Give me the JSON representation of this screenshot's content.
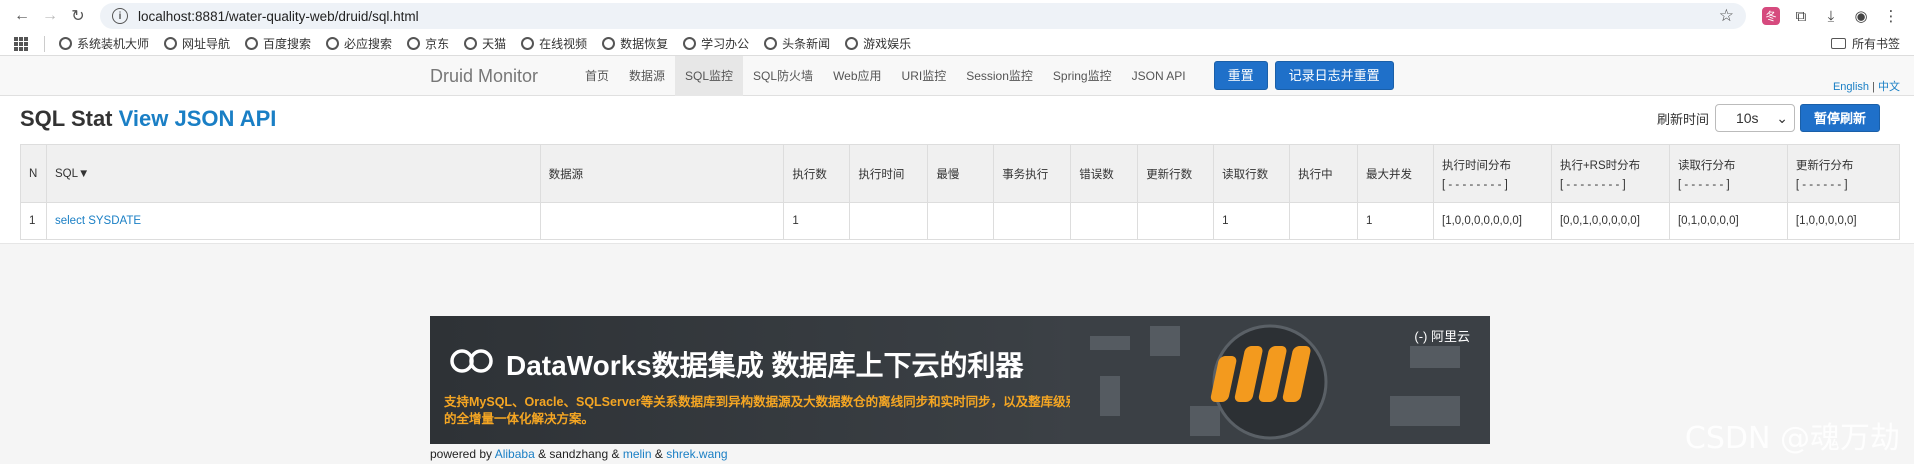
{
  "browser": {
    "url_host": "localhost",
    "url_rest": ":8881/water-quality-web/druid/sql.html",
    "bookmarks": [
      "系统装机大师",
      "网址导航",
      "百度搜索",
      "必应搜索",
      "京东",
      "天猫",
      "在线视频",
      "数据恢复",
      "学习办公",
      "头条新闻",
      "游戏娱乐"
    ],
    "all_bookmarks": "所有书签"
  },
  "navbar": {
    "brand": "Druid Monitor",
    "items": [
      "首页",
      "数据源",
      "SQL监控",
      "SQL防火墙",
      "Web应用",
      "URI监控",
      "Session监控",
      "Spring监控",
      "JSON API"
    ],
    "reset": "重置",
    "log_reset": "记录日志并重置",
    "lang_en": "English",
    "lang_sep": "|",
    "lang_zh": "中文"
  },
  "page": {
    "title": "SQL Stat",
    "title_link": "View JSON API",
    "refresh_label": "刷新时间",
    "refresh_value": "10s",
    "pause_button": "暂停刷新"
  },
  "table": {
    "headers": [
      "N",
      "SQL▼",
      "数据源",
      "执行数",
      "执行时间",
      "最慢",
      "事务执行",
      "错误数",
      "更新行数",
      "读取行数",
      "执行中",
      "最大并发",
      "执行时间分布",
      "执行+RS时分布",
      "读取行分布",
      "更新行分布"
    ],
    "dist_subs": [
      "[ - - - - - - - - ]",
      "[ - - - - - - - - ]",
      "[ - - - - - - ]",
      "[ - - - - - - ]"
    ],
    "rows": [
      [
        "1",
        "select SYSDATE",
        "",
        "1",
        "",
        "",
        "",
        "",
        "",
        "1",
        "",
        "1",
        "[1,0,0,0,0,0,0,0]",
        "[0,0,1,0,0,0,0,0]",
        "[0,1,0,0,0,0]",
        "[1,0,0,0,0,0]"
      ]
    ]
  },
  "banner": {
    "headline": "DataWorks数据集成 数据库上下云的利器",
    "subline": "支持MySQL、Oracle、SQLServer等关系数据库到异构数据源及大数据数仓的离线同步和实时同步，以及整库级别的全增量一体化解决方案。",
    "vendor": "(-) 阿里云"
  },
  "footer": {
    "prefix": "powered by",
    "alibaba": "Alibaba",
    "amp1": "& sandzhang &",
    "melin": "melin",
    "amp2": "&",
    "shrek": "shrek.wang"
  },
  "watermark": "CSDN @魂万劫"
}
